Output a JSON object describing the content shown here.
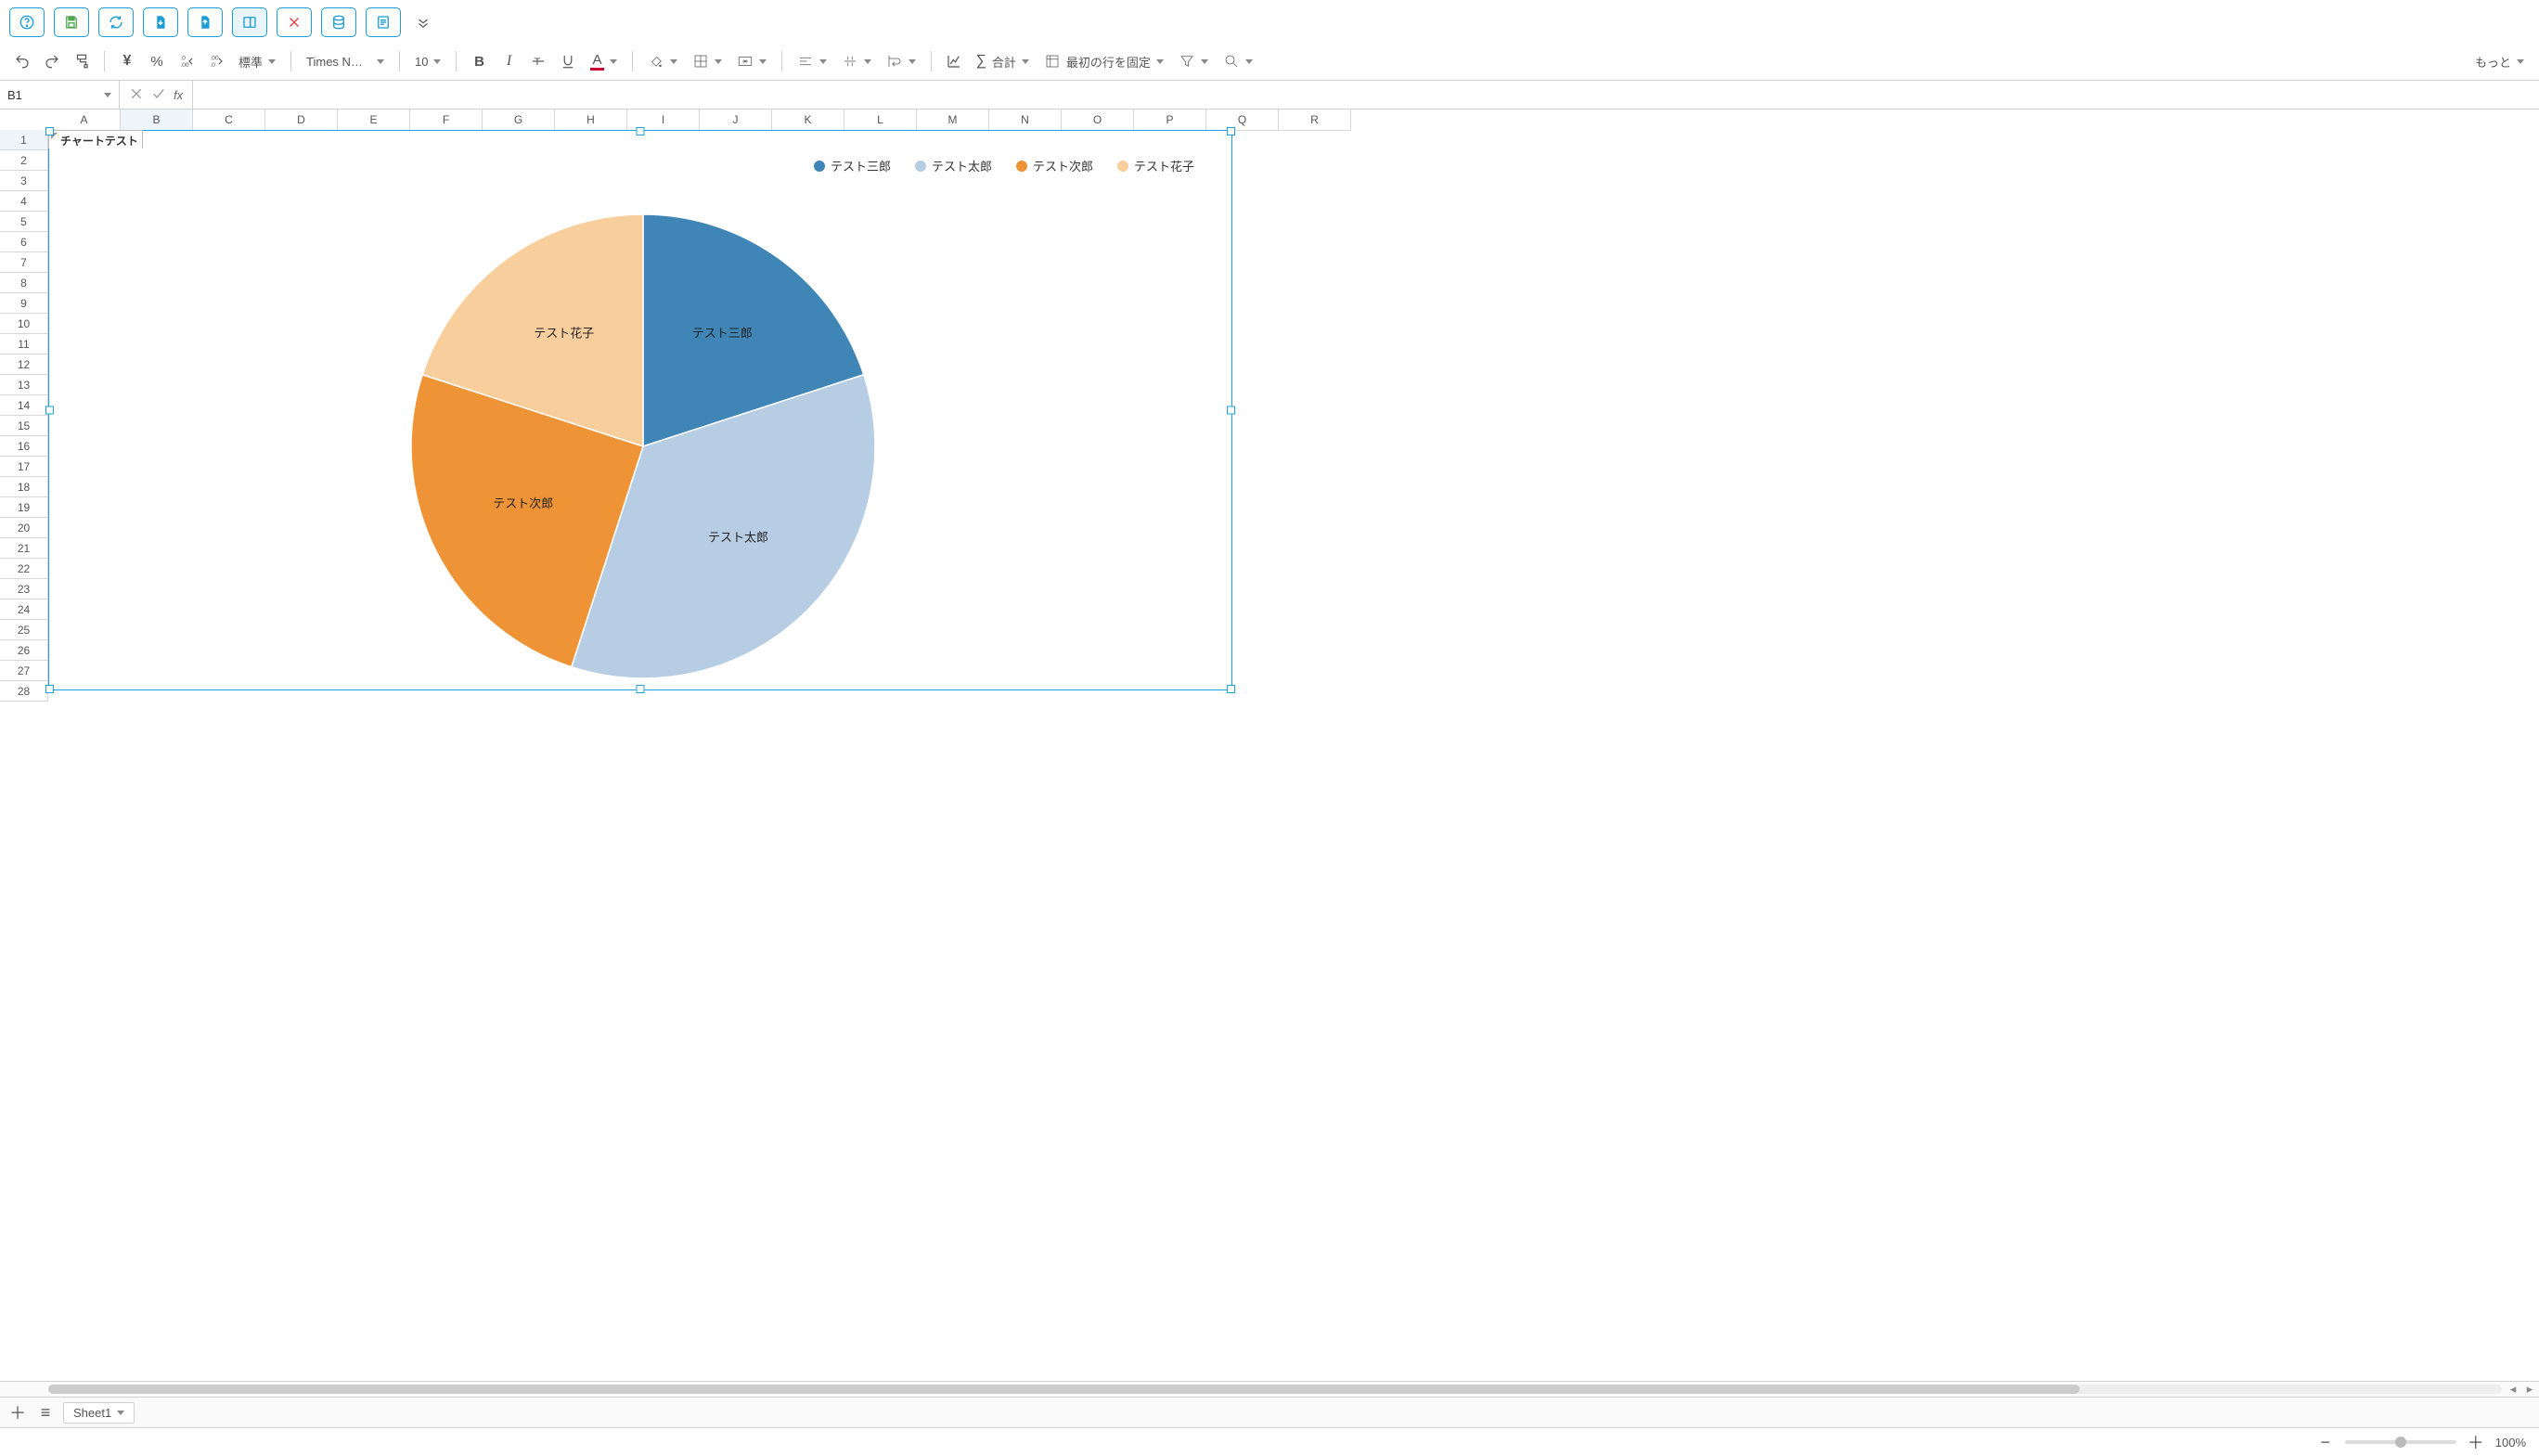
{
  "top_buttons": {
    "help": "help-icon",
    "save": "save-icon",
    "refresh": "refresh-icon",
    "import": "import-icon",
    "export": "export-icon",
    "sidepanel": "sidepanel-icon",
    "delete": "delete-icon",
    "database": "database-icon",
    "notes": "notes-icon",
    "expand": "expand-icon"
  },
  "toolbar": {
    "number_format": "標準",
    "font_family": "Times N…",
    "font_size": "10",
    "sum_label": "合計",
    "freeze_label": "最初の行を固定",
    "more_label": "もっと"
  },
  "formula_bar": {
    "cell_ref": "B1",
    "formula": ""
  },
  "columns": [
    "A",
    "B",
    "C",
    "D",
    "E",
    "F",
    "G",
    "H",
    "I",
    "J",
    "K",
    "L",
    "M",
    "N",
    "O",
    "P",
    "Q",
    "R"
  ],
  "rows": 28,
  "selected_col": "B",
  "selected_row": 1,
  "chart_title": "チャートテスト",
  "sheet": {
    "name": "Sheet1"
  },
  "zoom": "100%",
  "chart_data": {
    "type": "pie",
    "title": "チャートテスト",
    "series": [
      {
        "name": "テスト三郎",
        "value": 20,
        "color": "#3f85b6"
      },
      {
        "name": "テスト太郎",
        "value": 35,
        "color": "#b6cde3"
      },
      {
        "name": "テスト次郎",
        "value": 25,
        "color": "#ee9336"
      },
      {
        "name": "テスト花子",
        "value": 20,
        "color": "#f8ce9c"
      }
    ],
    "legend_position": "top-right"
  }
}
